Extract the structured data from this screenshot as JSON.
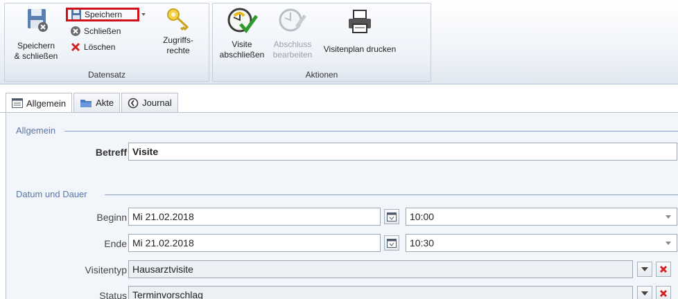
{
  "ribbon": {
    "groups": {
      "datensatz": "Datensatz",
      "aktionen": "Aktionen"
    },
    "save_close": "Speichern\n& schließen",
    "save_close_line1": "Speichern",
    "save_close_line2": "& schließen",
    "save": "Speichern",
    "close": "Schließen",
    "delete": "Löschen",
    "access_line1": "Zugriffs-",
    "access_line2": "rechte",
    "visit_close_line1": "Visite",
    "visit_close_line2": "abschließen",
    "edit_completion_line1": "Abschluss",
    "edit_completion_line2": "bearbeiten",
    "print_plan": "Visitenplan drucken"
  },
  "tabs": [
    {
      "label": "Allgemein",
      "icon": "form-icon"
    },
    {
      "label": "Akte",
      "icon": "folder-icon"
    },
    {
      "label": "Journal",
      "icon": "history-icon"
    }
  ],
  "sections": {
    "general": "Allgemein",
    "date_duration": "Datum und Dauer"
  },
  "form": {
    "subject_label": "Betreff",
    "subject_value": "Visite",
    "begin_label": "Beginn",
    "begin_date": "Mi 21.02.2018",
    "begin_time": "10:00",
    "end_label": "Ende",
    "end_date": "Mi 21.02.2018",
    "end_time": "10:30",
    "type_label": "Visitentyp",
    "type_value": "Hausarztvisite",
    "status_label": "Status",
    "status_value": "Terminvorschlag"
  },
  "colors": {
    "accent": "#5b76a6",
    "highlight": "#d0101a",
    "delete": "#d42020"
  }
}
